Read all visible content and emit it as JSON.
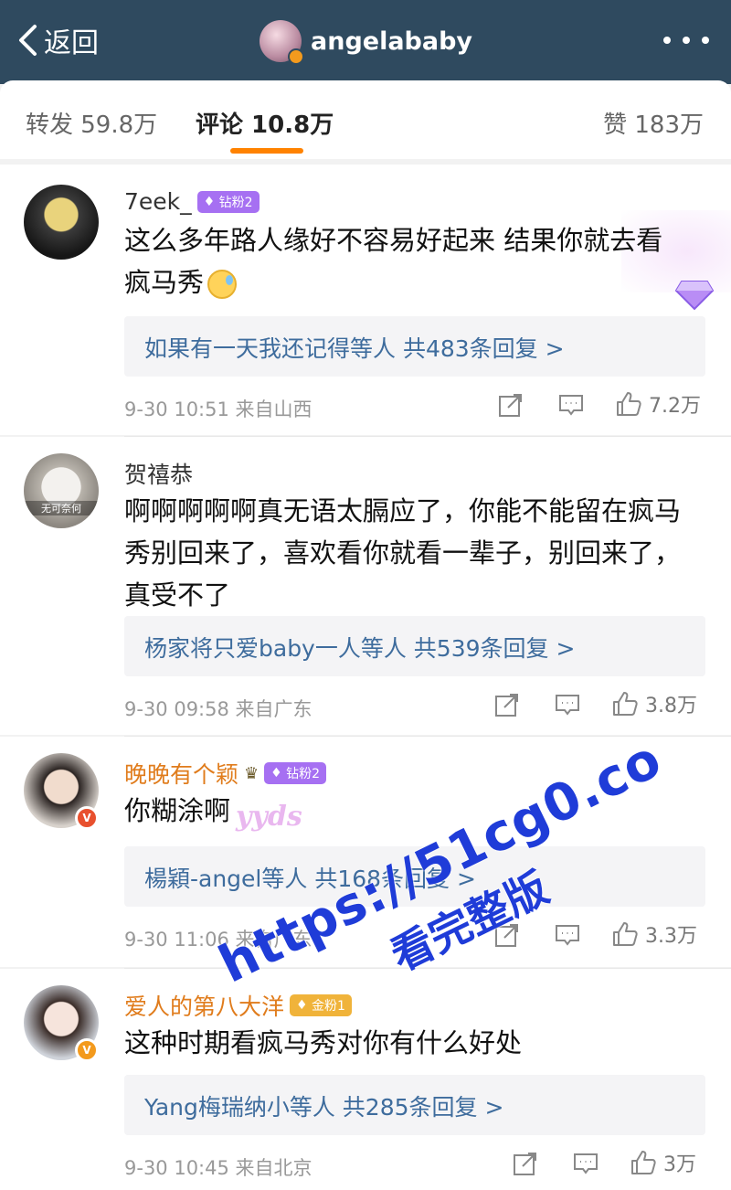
{
  "header": {
    "back_label": "返回",
    "title": "angelababy"
  },
  "tabs": [
    {
      "label": "转发 59.8万"
    },
    {
      "label": "评论 10.8万"
    },
    {
      "label": "赞 183万"
    }
  ],
  "comments": [
    {
      "username": "7eek_",
      "badge": "钻粉2",
      "text": "这么多年路人缘好不容易好起来 结果你就去看疯马秀",
      "replies": "如果有一天我还记得等人 共483条回复 >",
      "meta": "9-30 10:51 来自山西",
      "likes": "7.2万"
    },
    {
      "username": "贺禧恭",
      "avatar_caption": "无可奈何",
      "text": "啊啊啊啊啊真无语太膈应了，你能不能留在疯马秀别回来了，喜欢看你就看一辈子，别回来了，真受不了",
      "replies": "杨家将只爱baby一人等人 共539条回复 >",
      "meta": "9-30 09:58 来自广东",
      "likes": "3.8万"
    },
    {
      "username": "晚晚有个颖",
      "badge": "钻粉2",
      "text": "你糊涂啊",
      "sticker": "yyds",
      "replies": "楊穎-angel等人 共168条回复 >",
      "meta": "9-30 11:06 来自广东",
      "likes": "3.3万"
    },
    {
      "username": "爱人的第八大洋",
      "badge": "金粉1",
      "text": "这种时期看疯马秀对你有什么好处",
      "replies": "Yang梅瑞纳小等人 共285条回复 >",
      "meta": "9-30 10:45 来自北京",
      "likes": "3万"
    }
  ],
  "watermark": {
    "line1": "https://51cg0.co",
    "line2": "看完整版"
  },
  "colors": {
    "header_bg": "#2f4a5f",
    "tab_indicator": "#ff8200",
    "link": "#3e6c9d",
    "gold_name": "#e07c1c",
    "watermark": "#1f3cd8"
  }
}
